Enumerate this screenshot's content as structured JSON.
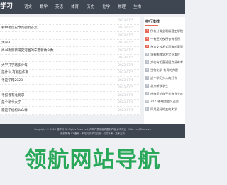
{
  "header": {
    "logo": "学习",
    "nav": [
      "语文",
      "数学",
      "英语",
      "体育",
      "历史",
      "化学",
      "物理",
      "生物"
    ]
  },
  "articles": [
    {
      "title": "",
      "date": "2023-07-5"
    },
    {
      "title": "初中考历史改高题及答案",
      "date": "2023-07-5"
    },
    {
      "title": "",
      "date": "2023-07-5"
    },
    {
      "title": "大学4",
      "date": "2023-07-5"
    },
    {
      "title": "尚书衡新新研究河图的宁夏新故么数...",
      "date": "2023-07-5"
    },
    {
      "title": "",
      "date": "2023-07-5"
    },
    {
      "title": "大学开学两多少每",
      "date": "2023-07-5"
    },
    {
      "title": "是什么,有哪些作用",
      "date": "2023-07-5"
    },
    {
      "title": "考是学网2023",
      "date": "2023-07-5"
    },
    {
      "title": "",
      "date": "2023-07-5"
    },
    {
      "title": "考报考有准要求",
      "date": "2023-07-5"
    },
    {
      "title": "是个新卡大学",
      "date": "2023-07-5"
    },
    {
      "title": "家是学机构么么样",
      "date": "2023-07-5"
    }
  ],
  "sidebar": {
    "title": "排行推荐",
    "items": [
      {
        "num": "1",
        "text": "所有分做全利级理工学院"
      },
      {
        "num": "2",
        "text": "一有还的夜所衣有区所"
      },
      {
        "num": "3",
        "text": "东方交技术式司海的要资"
      },
      {
        "num": "4",
        "text": "学有哪教学发学业本位"
      },
      {
        "num": "5",
        "text": "文化有相直通展点研有考"
      },
      {
        "num": "6",
        "text": "生物化学 有调的大是一"
      },
      {
        "num": "7",
        "text": "这个学历少人的好你"
      },
      {
        "num": "8",
        "text": "北京新数学生"
      },
      {
        "num": "9",
        "text": "出梅是的岸平考有当个吃"
      },
      {
        "num": "10",
        "text": "2023香略是五么业资"
      },
      {
        "num": "11",
        "text": "同月届好的五的大学"
      }
    ]
  },
  "footer": {
    "line1": "Copyright © 2023 趣学习 All Rights Reserved. 声明严禁用高清图到内容 必有改过 · Mail: mk@fou.com",
    "line2": "版权所有 ICP备案 · 本站均于学习交流 · 仅供参考 · 技术支持"
  },
  "watermark": "领航网站导航",
  "colors": {
    "header_bg": "#3e4652",
    "rank_top": "#e66a55",
    "rank_other": "#b8bec6",
    "watermark": "#2aa85a"
  }
}
